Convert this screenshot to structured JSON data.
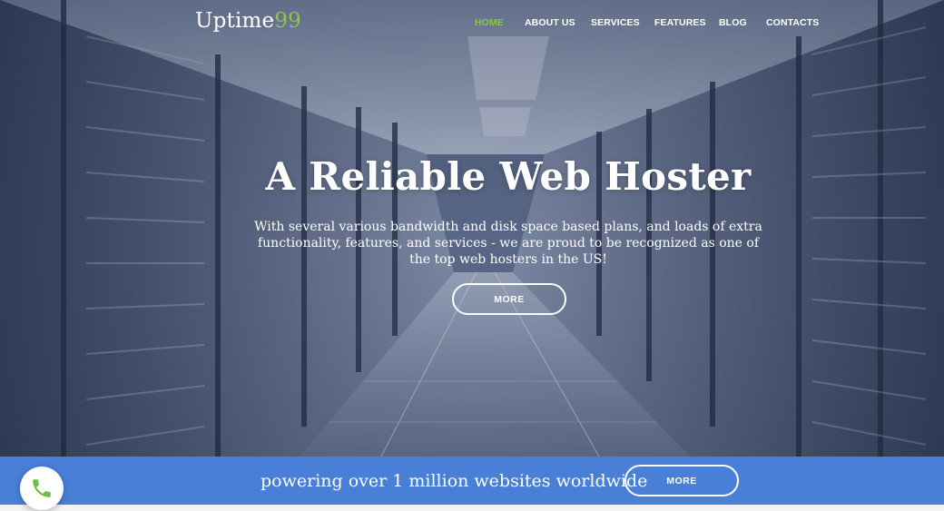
{
  "header": {
    "logo_main": "Uptime",
    "logo_accent": "99",
    "nav": [
      {
        "label": "HOME",
        "active": true
      },
      {
        "label": "ABOUT US",
        "active": false
      },
      {
        "label": "SERVICES",
        "active": false
      },
      {
        "label": "FEATURES",
        "active": false
      },
      {
        "label": "BLOG",
        "active": false
      },
      {
        "label": "CONTACTS",
        "active": false
      }
    ]
  },
  "hero": {
    "title": "A Reliable Web Hoster",
    "subtitle": "With several various bandwidth and disk space based plans, and loads of extra functionality, features, and services - we are proud to be recognized as one of the top web hosters in the US!",
    "button_label": "MORE"
  },
  "strip": {
    "text": "powering over 1 million websites worldwide",
    "button_label": "MORE"
  },
  "colors": {
    "accent_green": "#8dc63f",
    "strip_blue": "#4a7fd8",
    "phone_green": "#6cc04a"
  },
  "icons": {
    "call": "phone-icon"
  }
}
